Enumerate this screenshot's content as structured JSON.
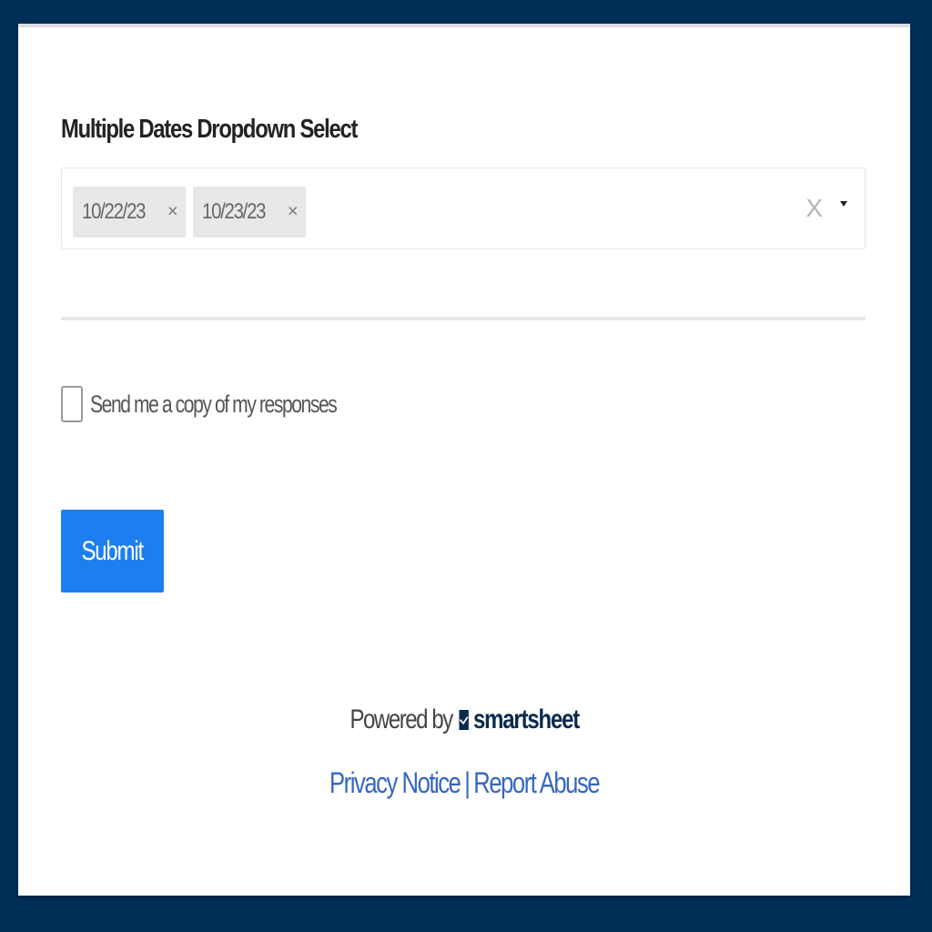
{
  "form": {
    "field_label": "Multiple Dates Dropdown Select",
    "selected_dates": [
      {
        "label": "10/22/23",
        "remove_icon": "×"
      },
      {
        "label": "10/23/23",
        "remove_icon": "×"
      }
    ],
    "clear_icon": "X",
    "caret_icon": "caret-down-icon",
    "copy_checkbox_checked": false,
    "copy_label": "Send me a copy of my responses",
    "submit_label": "Submit"
  },
  "footer": {
    "powered_by": "Powered by",
    "brand_name": "smartsheet",
    "privacy_label": "Privacy Notice",
    "separator": "|",
    "report_label": "Report Abuse"
  },
  "colors": {
    "page_background": "#012e57",
    "card_background": "#ffffff",
    "submit_button": "#1d7ef0",
    "link": "#3566c2",
    "chip_background": "#e8e8e8"
  }
}
